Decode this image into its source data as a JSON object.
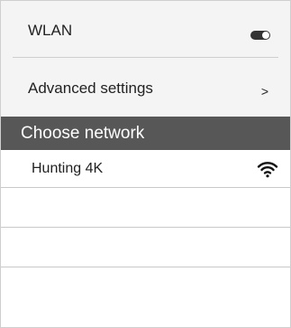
{
  "settings": {
    "wlan": {
      "label": "WLAN",
      "enabled": true
    },
    "advanced": {
      "label": "Advanced settings",
      "chevron": ">"
    }
  },
  "network_section": {
    "header": "Choose network",
    "networks": [
      {
        "name": "Hunting 4K",
        "icon": "wifi-icon"
      }
    ]
  },
  "colors": {
    "header_bg": "#575757",
    "top_bg": "#f4f4f4",
    "divider": "#c9c9c9"
  }
}
